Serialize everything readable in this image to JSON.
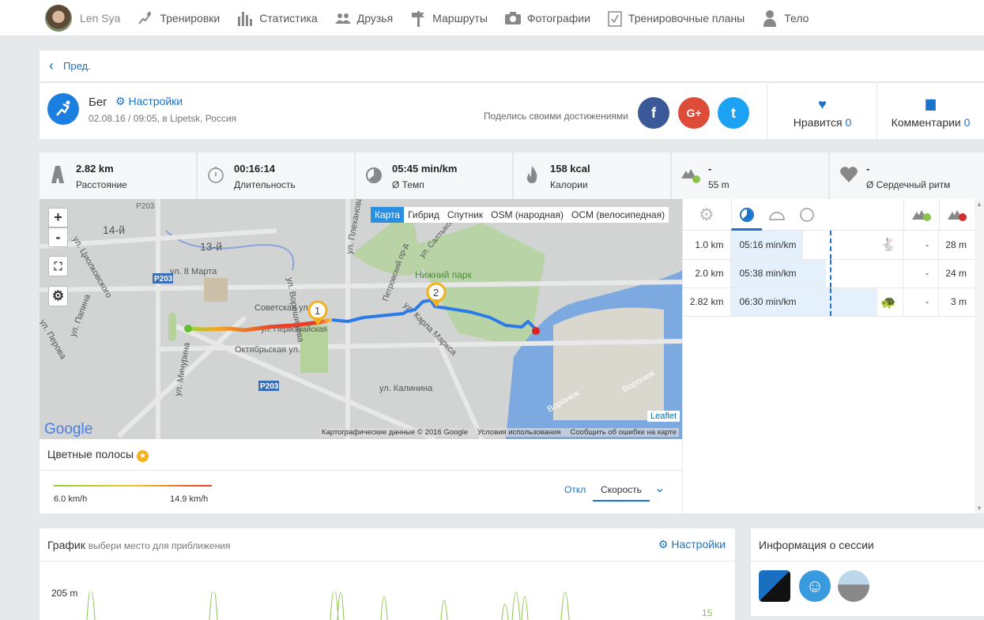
{
  "nav": {
    "user": "Len Sya",
    "items": [
      "Тренировки",
      "Статистика",
      "Друзья",
      "Маршруты",
      "Фотографии",
      "Тренировочные планы",
      "Тело"
    ]
  },
  "back": "Пред.",
  "activity": {
    "type": "Бег",
    "settings": "Настройки",
    "date": "02.08.16 / 09:05, в Lipetsk, Россия",
    "share": "Поделись своими достижениями",
    "like_label": "Нравится",
    "like_count": "0",
    "comments_label": "Комментарии",
    "comments_count": "0",
    "social": {
      "facebook": "f",
      "google": "G+",
      "twitter": "t"
    }
  },
  "stats": [
    {
      "value": "2.82 km",
      "label": "Расстояние"
    },
    {
      "value": "00:16:14",
      "label": "Длительность"
    },
    {
      "value": "05:45 min/km",
      "label": "Ø Темп"
    },
    {
      "value": "158 kcal",
      "label": "Калории"
    },
    {
      "value": "-",
      "label": "55 m"
    },
    {
      "value": "-",
      "label": "Ø Сердечный ритм"
    }
  ],
  "map": {
    "types": [
      "Карта",
      "Гибрид",
      "Спутник",
      "OSM (народная)",
      "OCM (велосипедная)"
    ],
    "zoom_in": "+",
    "zoom_out": "-",
    "labels": [
      "14-й",
      "13-й",
      "Р203",
      "Р203",
      "Р203",
      "ул. 8 Марта",
      "Советская ул.",
      "Октябрьская ул.",
      "Нижний парк",
      "ул. Калинина",
      "Воронеж",
      "Воронеж",
      "ул. Циолковского",
      "ул. Ворошилова",
      "ул. Плеханова",
      "Петровский пр-д",
      "ул. Салтыкова",
      "ул. Карла Маркса",
      "ул. Мичурина",
      "ул. Папина",
      "ул. Перова",
      "ул. Первомайская"
    ],
    "markers": [
      "1",
      "2"
    ],
    "google": "Google",
    "leaflet": "Leaflet",
    "attribution": [
      "Картографические данные © 2016 Google",
      "Условия использования",
      "Сообщить об ошибке на карте"
    ]
  },
  "stripes": {
    "title": "Цветные полосы",
    "min": "6.0 km/h",
    "max": "14.9 km/h",
    "off": "Откл",
    "speed": "Скорость"
  },
  "laps": [
    {
      "dist": "1.0 km",
      "pace": "05:16 min/km",
      "fill": 0.42,
      "icon": "rabbit",
      "up": "-",
      "down": "28 m"
    },
    {
      "dist": "2.0 km",
      "pace": "05:38 min/km",
      "fill": 0.55,
      "icon": "",
      "up": "-",
      "down": "24 m"
    },
    {
      "dist": "2.82 km",
      "pace": "06:30 min/km",
      "fill": 0.85,
      "icon": "turtle",
      "up": "-",
      "down": "3 m"
    }
  ],
  "graph": {
    "title": "График",
    "hint": "выбери место для приближения",
    "settings": "Настройки",
    "y_label": "205 m",
    "right_label": "15"
  },
  "session": {
    "title": "Информация о сессии"
  }
}
